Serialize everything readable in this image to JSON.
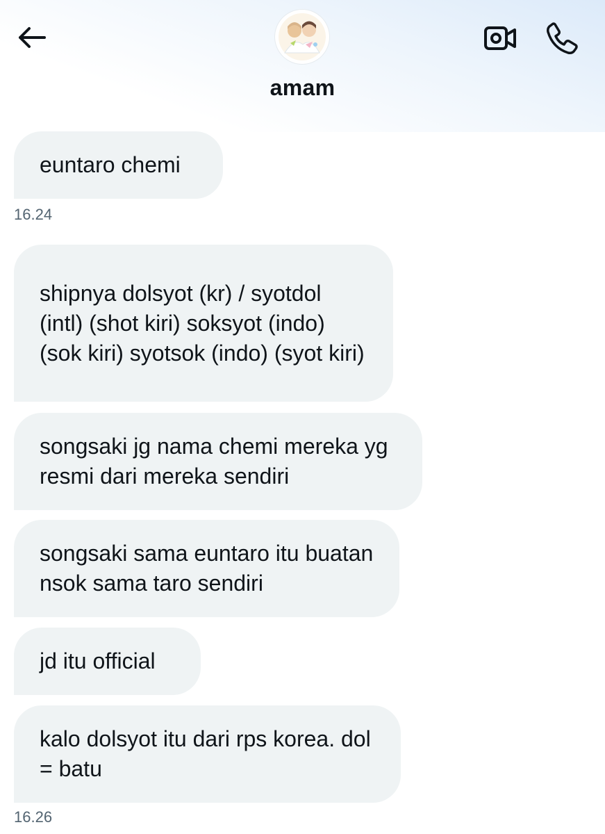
{
  "header": {
    "contact_name": "amam",
    "back_icon": "arrow-left-icon",
    "video_icon": "video-camera-icon",
    "call_icon": "phone-icon"
  },
  "messages": [
    {
      "text": "euntaro chemi"
    },
    {
      "text": "shipnya dolsyot (kr) / syotdol (intl) (shot kiri) soksyot (indo) (sok kiri) syotsok (indo) (syot kiri)"
    },
    {
      "text": "songsaki jg nama chemi mereka yg resmi dari mereka sendiri"
    },
    {
      "text": "songsaki sama euntaro itu buatan nsok sama taro sendiri"
    },
    {
      "text": "jd itu official"
    },
    {
      "text": "kalo dolsyot itu dari rps korea. dol = batu"
    }
  ],
  "timestamps": [
    "16.24",
    "16.26"
  ],
  "colors": {
    "bubble_bg": "#eff3f4",
    "text": "#0f1419",
    "timestamp": "#536471",
    "header_tint": "#dceaf9"
  }
}
